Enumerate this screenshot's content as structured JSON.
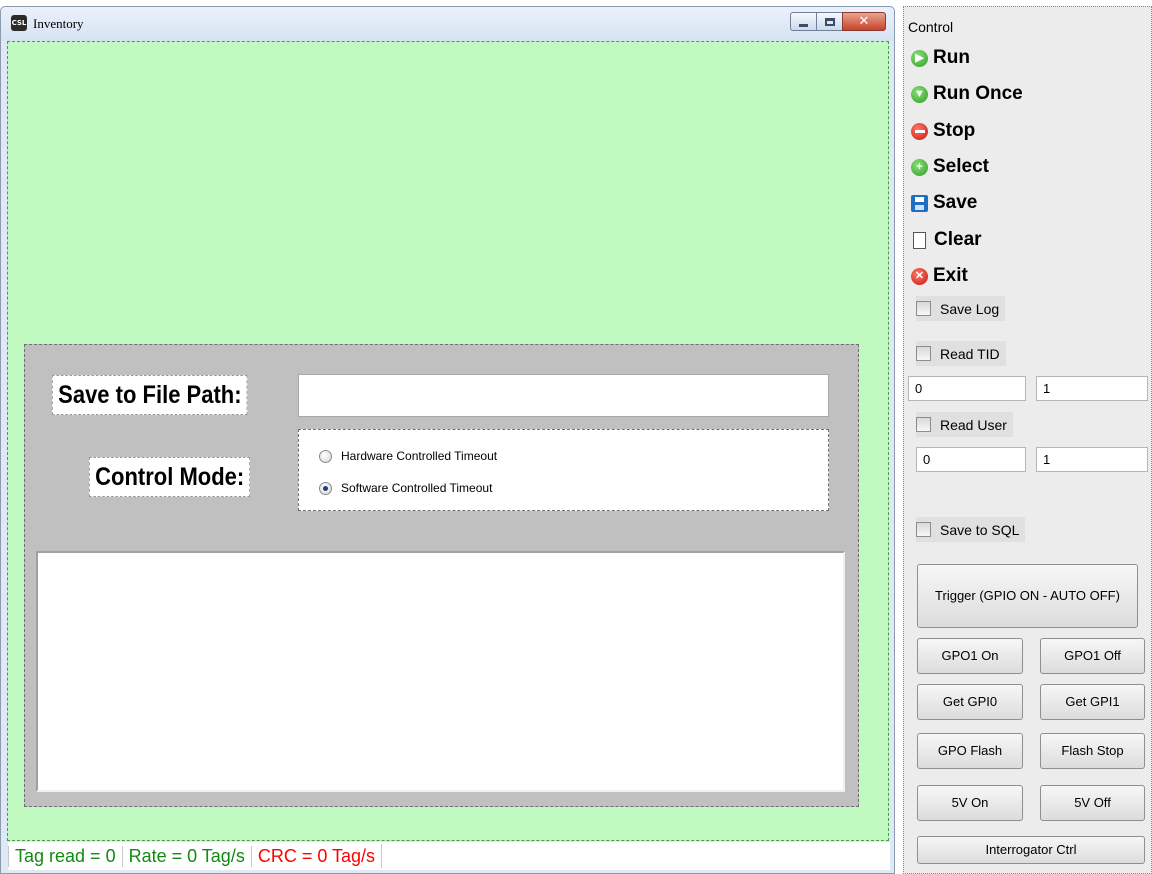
{
  "window": {
    "icon_text": "CSL",
    "title": "Inventory"
  },
  "form": {
    "path_label": "Save to File Path:",
    "path_value": "",
    "mode_label": "Control Mode:",
    "radio_options": [
      {
        "label": "Hardware Controlled Timeout",
        "selected": false
      },
      {
        "label": "Software Controlled Timeout",
        "selected": true
      }
    ]
  },
  "status": {
    "tag_read": "Tag read = 0",
    "rate": "Rate = 0 Tag/s",
    "crc": "CRC = 0 Tag/s",
    "colors": {
      "ok": "#138a13",
      "error": "#ff0000"
    }
  },
  "control": {
    "title": "Control",
    "commands": [
      {
        "label": "Run",
        "icon": "play-icon"
      },
      {
        "label": "Run Once",
        "icon": "run-once-icon"
      },
      {
        "label": "Stop",
        "icon": "stop-icon"
      },
      {
        "label": "Select",
        "icon": "select-icon"
      },
      {
        "label": "Save",
        "icon": "floppy-disk-icon"
      },
      {
        "label": "Clear",
        "icon": "blank-page-icon"
      },
      {
        "label": "Exit",
        "icon": "exit-icon"
      }
    ],
    "save_log": {
      "label": "Save Log",
      "checked": false
    },
    "read_tid": {
      "label": "Read TID",
      "checked": false,
      "start": "0",
      "length": "1"
    },
    "read_user": {
      "label": "Read User",
      "checked": false,
      "start": "0",
      "length": "1"
    },
    "save_sql": {
      "label": "Save to SQL",
      "checked": false
    },
    "buttons": {
      "trigger": "Trigger (GPIO ON - AUTO OFF)",
      "gpo1_on": "GPO1 On",
      "gpo1_off": "GPO1 Off",
      "get_gpi0": "Get GPI0",
      "get_gpi1": "Get GPI1",
      "gpo_flash": "GPO Flash",
      "flash_stop": "Flash Stop",
      "v5_on": "5V On",
      "v5_off": "5V Off",
      "interrogator": "Interrogator Ctrl"
    }
  }
}
